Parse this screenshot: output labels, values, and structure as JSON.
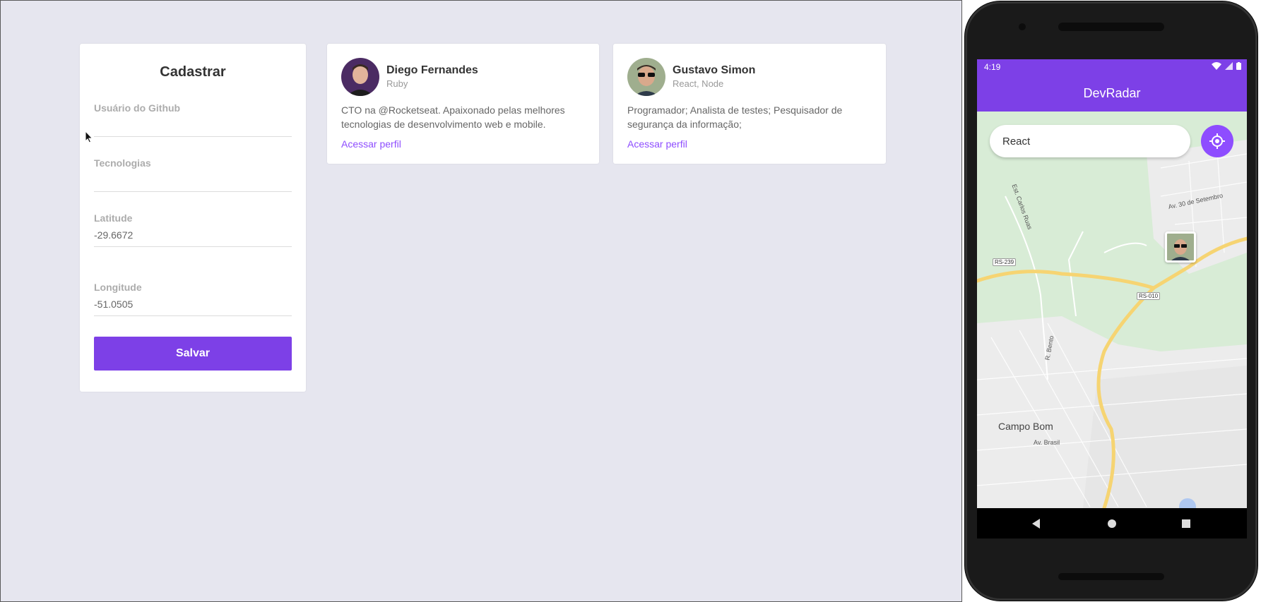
{
  "form": {
    "title": "Cadastrar",
    "github_label": "Usuário do Github",
    "github_value": "",
    "techs_label": "Tecnologias",
    "techs_value": "",
    "latitude_label": "Latitude",
    "latitude_value": "-29.6672",
    "longitude_label": "Longitude",
    "longitude_value": "-51.0505",
    "save_label": "Salvar"
  },
  "devs": [
    {
      "name": "Diego Fernandes",
      "techs": "Ruby",
      "bio": "CTO na @Rocketseat. Apaixonado pelas melhores tecnologias de desenvolvimento web e mobile.",
      "link_label": "Acessar perfil",
      "avatar_icon": "avatar-photo"
    },
    {
      "name": "Gustavo Simon",
      "techs": "React, Node",
      "bio": "Programador; Analista de testes; Pesquisador de segurança da informação;",
      "link_label": "Acessar perfil",
      "avatar_icon": "avatar-photo"
    }
  ],
  "phone": {
    "status_time": "4:19",
    "status_icons": [
      "wifi-icon",
      "signal-icon",
      "battery-icon"
    ],
    "app_title": "DevRadar",
    "search_value": "React",
    "locate_icon": "my-location-icon",
    "map": {
      "city_label": "Campo Bom",
      "road_badges": [
        "RS-239",
        "RS-010"
      ],
      "street_labels": [
        "Est. Carlos Ruas",
        "Av. 30 de Setembro",
        "R. Bento",
        "Av. Brasil"
      ]
    },
    "nav": [
      "back-icon",
      "home-icon",
      "recents-icon"
    ]
  },
  "colors": {
    "background": "#e6e6ef",
    "primary": "#7d40e7",
    "link": "#8e4dff",
    "map_green": "#d8ecd6",
    "road_yellow": "#f6d472"
  }
}
